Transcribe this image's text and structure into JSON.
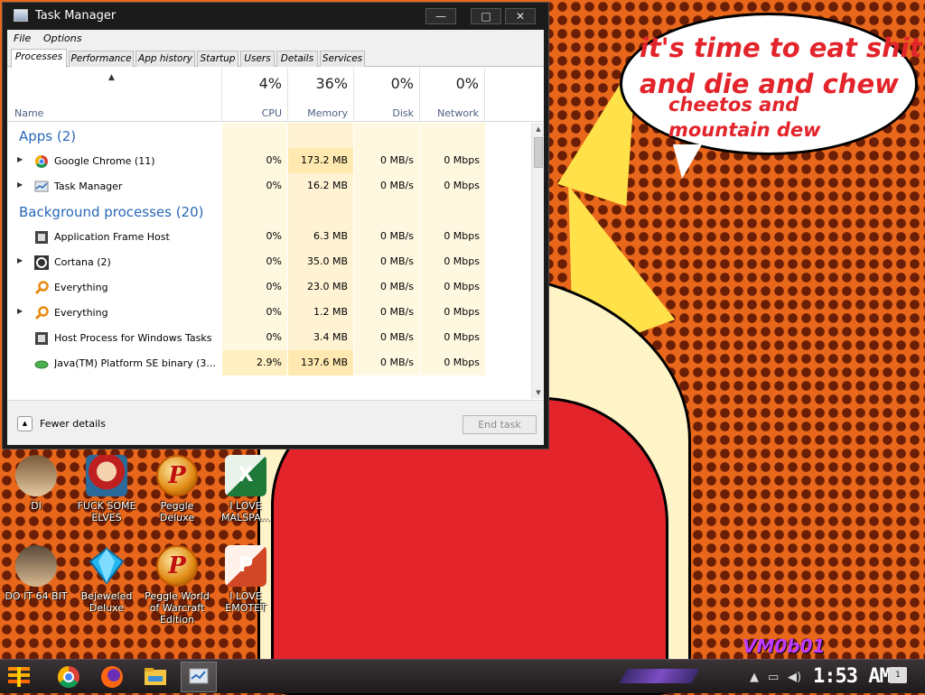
{
  "wallpaper": {
    "speech_lines": [
      "it's time to eat shit",
      "and die and chew",
      "cheetos and",
      "mountain dew"
    ],
    "signature": "VM0b01"
  },
  "window": {
    "title": "Task Manager",
    "minimize": "—",
    "maximize": "□",
    "close": "✕"
  },
  "menu": {
    "file": "File",
    "options": "Options"
  },
  "tabs": [
    "Processes",
    "Performance",
    "App history",
    "Startup",
    "Users",
    "Details",
    "Services"
  ],
  "columns": {
    "name": "Name",
    "sort_glyph": "▲",
    "cpu": {
      "pct": "4%",
      "label": "CPU"
    },
    "memory": {
      "pct": "36%",
      "label": "Memory"
    },
    "disk": {
      "pct": "0%",
      "label": "Disk"
    },
    "network": {
      "pct": "0%",
      "label": "Network"
    }
  },
  "groups": {
    "apps": "Apps (2)",
    "background": "Background processes (20)"
  },
  "processes": [
    {
      "name": "Google Chrome (11)",
      "expandable": true,
      "icon": "chrome-icon",
      "cpu": "0%",
      "memory": "173.2 MB",
      "disk": "0 MB/s",
      "network": "0 Mbps"
    },
    {
      "name": "Task Manager",
      "expandable": true,
      "icon": "task-manager-icon",
      "cpu": "0%",
      "memory": "16.2 MB",
      "disk": "0 MB/s",
      "network": "0 Mbps"
    },
    {
      "name": "Application Frame Host",
      "expandable": false,
      "icon": "app-frame-icon",
      "cpu": "0%",
      "memory": "6.3 MB",
      "disk": "0 MB/s",
      "network": "0 Mbps"
    },
    {
      "name": "Cortana (2)",
      "expandable": true,
      "icon": "cortana-icon",
      "cpu": "0%",
      "memory": "35.0 MB",
      "disk": "0 MB/s",
      "network": "0 Mbps"
    },
    {
      "name": "Everything",
      "expandable": false,
      "icon": "everything-icon",
      "cpu": "0%",
      "memory": "23.0 MB",
      "disk": "0 MB/s",
      "network": "0 Mbps"
    },
    {
      "name": "Everything",
      "expandable": true,
      "icon": "everything-icon",
      "cpu": "0%",
      "memory": "1.2 MB",
      "disk": "0 MB/s",
      "network": "0 Mbps"
    },
    {
      "name": "Host Process for Windows Tasks",
      "expandable": false,
      "icon": "host-process-icon",
      "cpu": "0%",
      "memory": "3.4 MB",
      "disk": "0 MB/s",
      "network": "0 Mbps"
    },
    {
      "name": "Java(TM) Platform SE binary (3...",
      "expandable": false,
      "icon": "java-icon",
      "cpu": "2.9%",
      "memory": "137.6 MB",
      "disk": "0 MB/s",
      "network": "0 Mbps"
    }
  ],
  "footer": {
    "fewer_details": "Fewer details",
    "end_task": "End task"
  },
  "desktop_icons": [
    {
      "label": "DI",
      "icon": "portrait-icon"
    },
    {
      "label": "FUCK SOME ELVES",
      "icon": "santa-icon"
    },
    {
      "label": "Peggle Deluxe",
      "icon": "peggle-icon",
      "badge": "P"
    },
    {
      "label": "I LOVE MALSPA...",
      "icon": "excel-icon",
      "badge": "X"
    },
    {
      "label": "DO IT 64 BIT",
      "icon": "portrait-64-icon"
    },
    {
      "label": "Bejeweled Deluxe",
      "icon": "gem-icon"
    },
    {
      "label": "Peggle World of Warcraft Edition",
      "icon": "peggle-wow-icon",
      "badge": "P"
    },
    {
      "label": "I LOVE EMOTET",
      "icon": "powerpoint-icon",
      "badge": "P"
    }
  ],
  "taskbar": {
    "clock": "1:53 AM",
    "notifications": "1",
    "colors": {
      "accent": "#7c4cc4"
    }
  }
}
